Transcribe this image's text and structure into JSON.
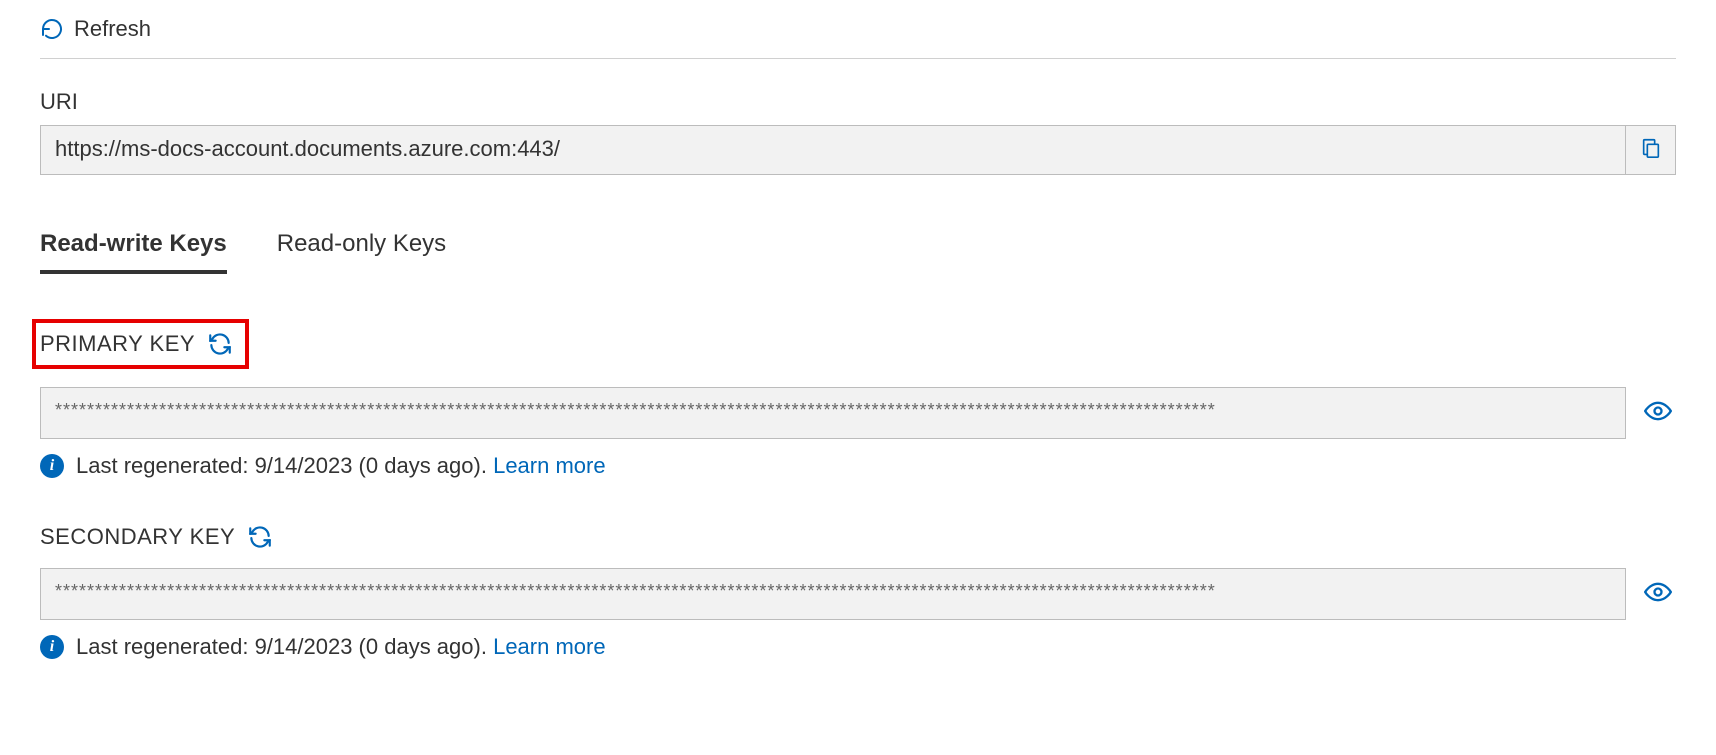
{
  "toolbar": {
    "refresh_label": "Refresh"
  },
  "uri": {
    "label": "URI",
    "value": "https://ms-docs-account.documents.azure.com:443/"
  },
  "tabs": {
    "read_write": "Read-write Keys",
    "read_only": "Read-only Keys"
  },
  "primary": {
    "title": "PRIMARY KEY",
    "value": "*************************************************************************************************************************************************",
    "info_text": "Last regenerated: 9/14/2023 (0 days ago). ",
    "learn_more": "Learn more"
  },
  "secondary": {
    "title": "SECONDARY KEY",
    "value": "*************************************************************************************************************************************************",
    "info_text": "Last regenerated: 9/14/2023 (0 days ago). ",
    "learn_more": "Learn more"
  }
}
